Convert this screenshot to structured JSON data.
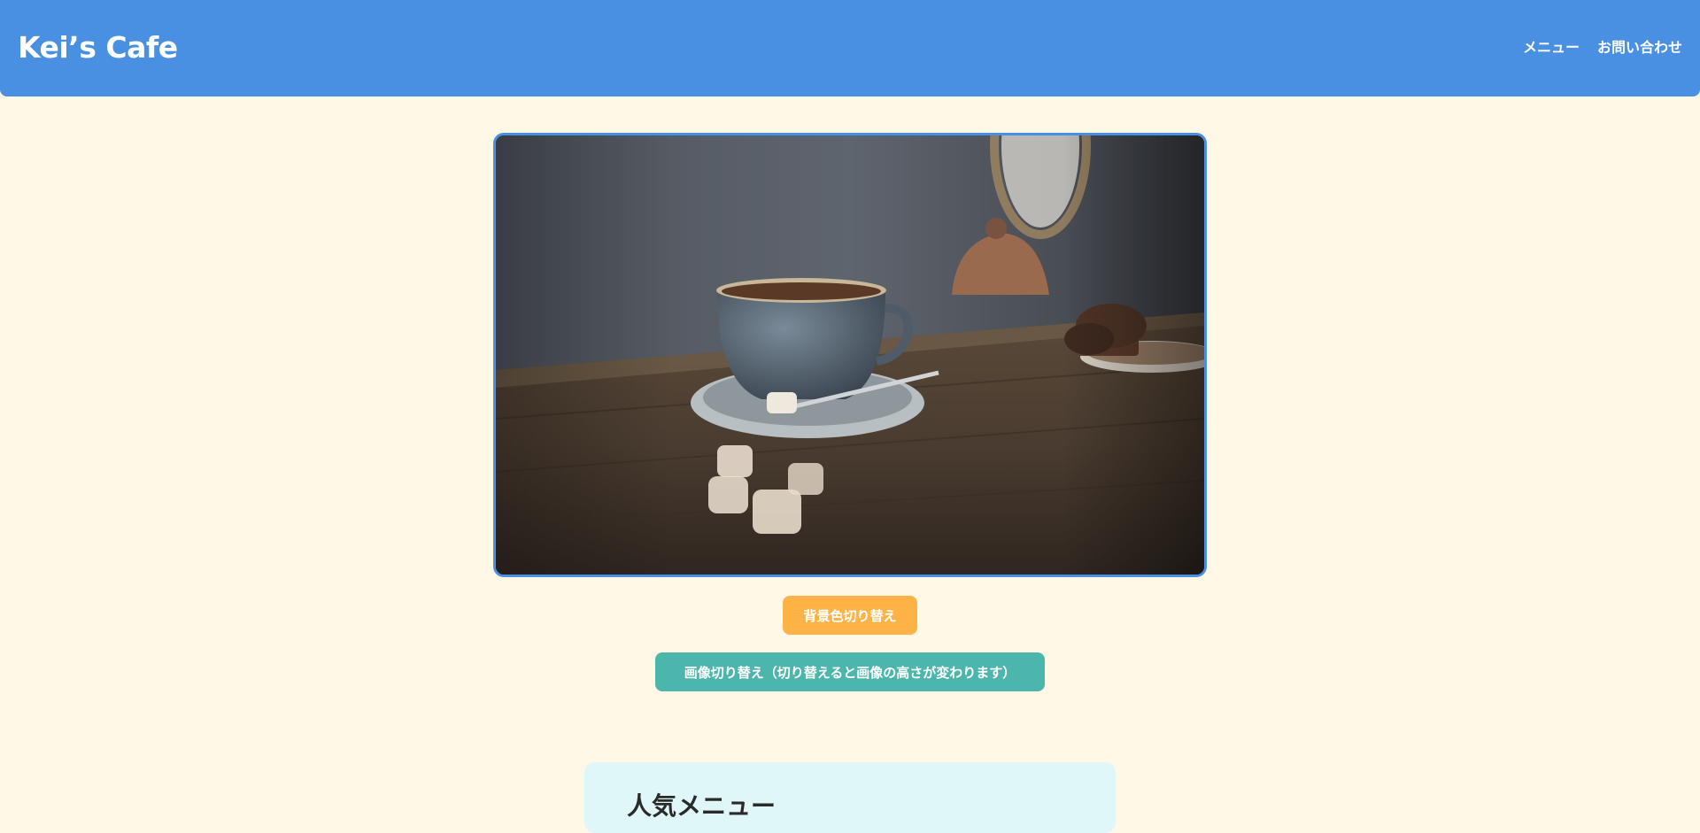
{
  "header": {
    "logo": "Kei’s Cafe",
    "nav": [
      "メニュー",
      "お問い合わせ"
    ]
  },
  "hero": {
    "image_description": "コーヒーカップ"
  },
  "buttons": {
    "toggle_background": "背景色切り替え",
    "toggle_image": "画像切り替え（切り替えると画像の高さが変わります）"
  },
  "menu_section": {
    "title": "人気メニュー"
  },
  "colors": {
    "header": "#4a90e2",
    "page_background": "#fff8e7",
    "button_background_toggle": "#ffb347",
    "button_image_toggle": "#4db6ac",
    "menu_section_background": "#e0f7fa"
  }
}
